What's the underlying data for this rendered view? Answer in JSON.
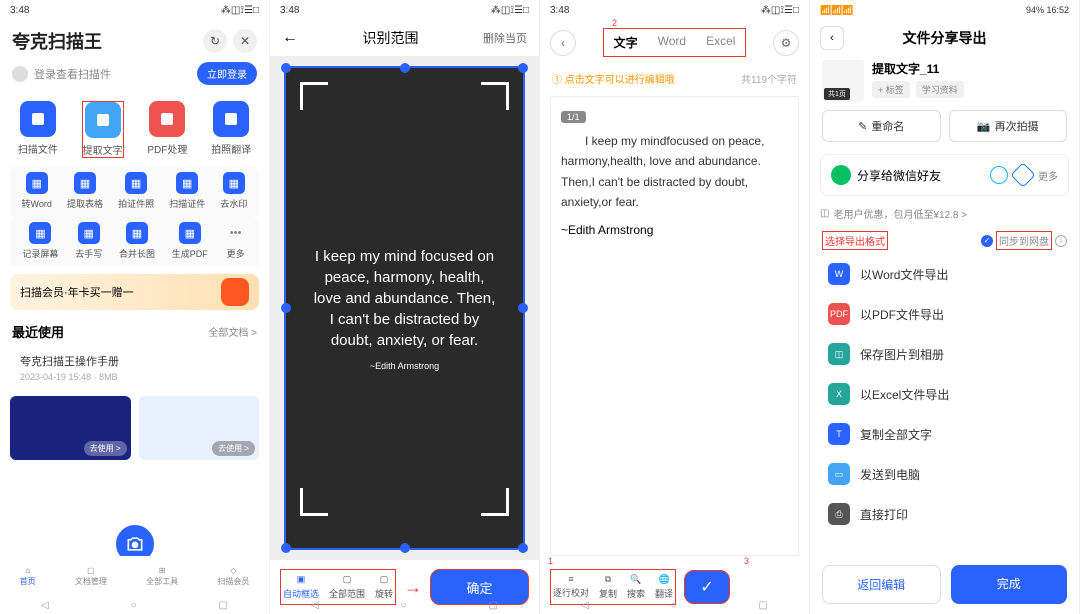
{
  "status": {
    "time": "3:48",
    "icons": "⁂◫⟟☰□",
    "time4": "16:52",
    "batt4": "94%"
  },
  "s1": {
    "title": "夸克扫描王",
    "login_text": "登录查看扫描件",
    "login_btn": "立即登录",
    "grid4": [
      {
        "label": "扫描文件",
        "color": "blue"
      },
      {
        "label": "提取文字",
        "color": "lblue",
        "hl": true
      },
      {
        "label": "PDF处理",
        "color": "red"
      },
      {
        "label": "拍照翻译",
        "color": "blue"
      }
    ],
    "grid5a": [
      {
        "label": "转Word"
      },
      {
        "label": "提取表格"
      },
      {
        "label": "拍证件照"
      },
      {
        "label": "扫描证件"
      },
      {
        "label": "去水印"
      }
    ],
    "grid5b": [
      {
        "label": "记录屏幕"
      },
      {
        "label": "去手写"
      },
      {
        "label": "合并长图"
      },
      {
        "label": "生成PDF"
      },
      {
        "label": "更多"
      }
    ],
    "promo": "扫描会员·年卡买一赠一",
    "recent": "最近使用",
    "recent_more": "全部文档 >",
    "doc_name": "夸克扫描王操作手册",
    "doc_meta": "2023-04-19 15:48 · 8MB",
    "card_tag": "去使用 >",
    "tabs": [
      "首页",
      "文档管理",
      "",
      "全部工具",
      "扫描会员"
    ]
  },
  "s2": {
    "title": "识别范围",
    "delete": "删除当页",
    "photo_text": "I keep my mind focused on peace, harmony, health, love and abundance. Then, I can't be distracted by doubt, anxiety, or fear.",
    "photo_author": "~Edith Armstrong",
    "actions": [
      {
        "label": "自动框选",
        "active": true
      },
      {
        "label": "全部范围"
      },
      {
        "label": "旋转"
      }
    ],
    "confirm": "确定"
  },
  "s3": {
    "tabs": [
      "文字",
      "Word",
      "Excel"
    ],
    "tip": "① 点击文字可以进行编辑哦",
    "count": "共119个字符",
    "page": "1/1",
    "text": "I keep my mindfocused on peace, harmony,health, love and abundance. Then,I can't be distracted by doubt, anxiety,or fear.",
    "author": "~Edith Armstrong",
    "actions": [
      "逐行校对",
      "复制",
      "搜索",
      "翻译"
    ]
  },
  "s4": {
    "title": "文件分享导出",
    "file_name": "提取文字_11",
    "thumb_badge": "共1页",
    "tags": [
      "+ 标签",
      "学习资料"
    ],
    "rename": "重命名",
    "reshoot": "再次拍摄",
    "share_wx": "分享给微信好友",
    "more": "更多",
    "promo": "老用户优惠，包月低至¥12.8 >",
    "format_label": "选择导出格式",
    "sync": "同步到网盘",
    "exports": [
      {
        "label": "以Word文件导出",
        "color": "#2962ff",
        "t": "W"
      },
      {
        "label": "以PDF文件导出",
        "color": "#ef5350",
        "t": "PDF"
      },
      {
        "label": "保存图片到相册",
        "color": "#26a69a",
        "t": "◫"
      },
      {
        "label": "以Excel文件导出",
        "color": "#26a69a",
        "t": "X"
      },
      {
        "label": "复制全部文字",
        "color": "#2962ff",
        "t": "T"
      },
      {
        "label": "发送到电脑",
        "color": "#42a5f5",
        "t": "▭"
      },
      {
        "label": "直接打印",
        "color": "#555",
        "t": "⎙"
      }
    ],
    "back": "返回编辑",
    "done": "完成"
  }
}
